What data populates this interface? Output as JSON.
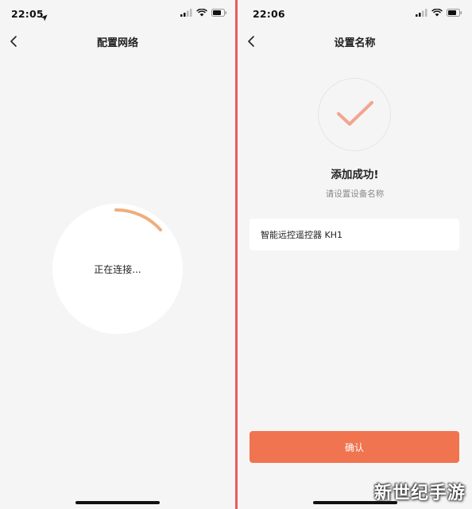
{
  "left_screen": {
    "status_bar": {
      "time": "22:05",
      "location_icon": "location-arrow-icon"
    },
    "nav": {
      "title": "配置网络",
      "back_icon": "chevron-left-icon"
    },
    "connecting_text": "正在连接...",
    "progress_color": "#efae7c"
  },
  "right_screen": {
    "status_bar": {
      "time": "22:06"
    },
    "nav": {
      "title": "设置名称",
      "back_icon": "chevron-left-icon"
    },
    "success": {
      "icon": "checkmark-icon",
      "title": "添加成功!",
      "subtitle": "请设置设备名称"
    },
    "device_name_input": {
      "value": "智能远控遥控器 KH1"
    },
    "confirm_button": {
      "label": "确认"
    }
  },
  "watermark": {
    "text": "新世纪手游"
  },
  "colors": {
    "accent": "#ef744f",
    "check": "#f2a58e",
    "divider": "#e95b5b",
    "background": "#f6f5f5"
  }
}
